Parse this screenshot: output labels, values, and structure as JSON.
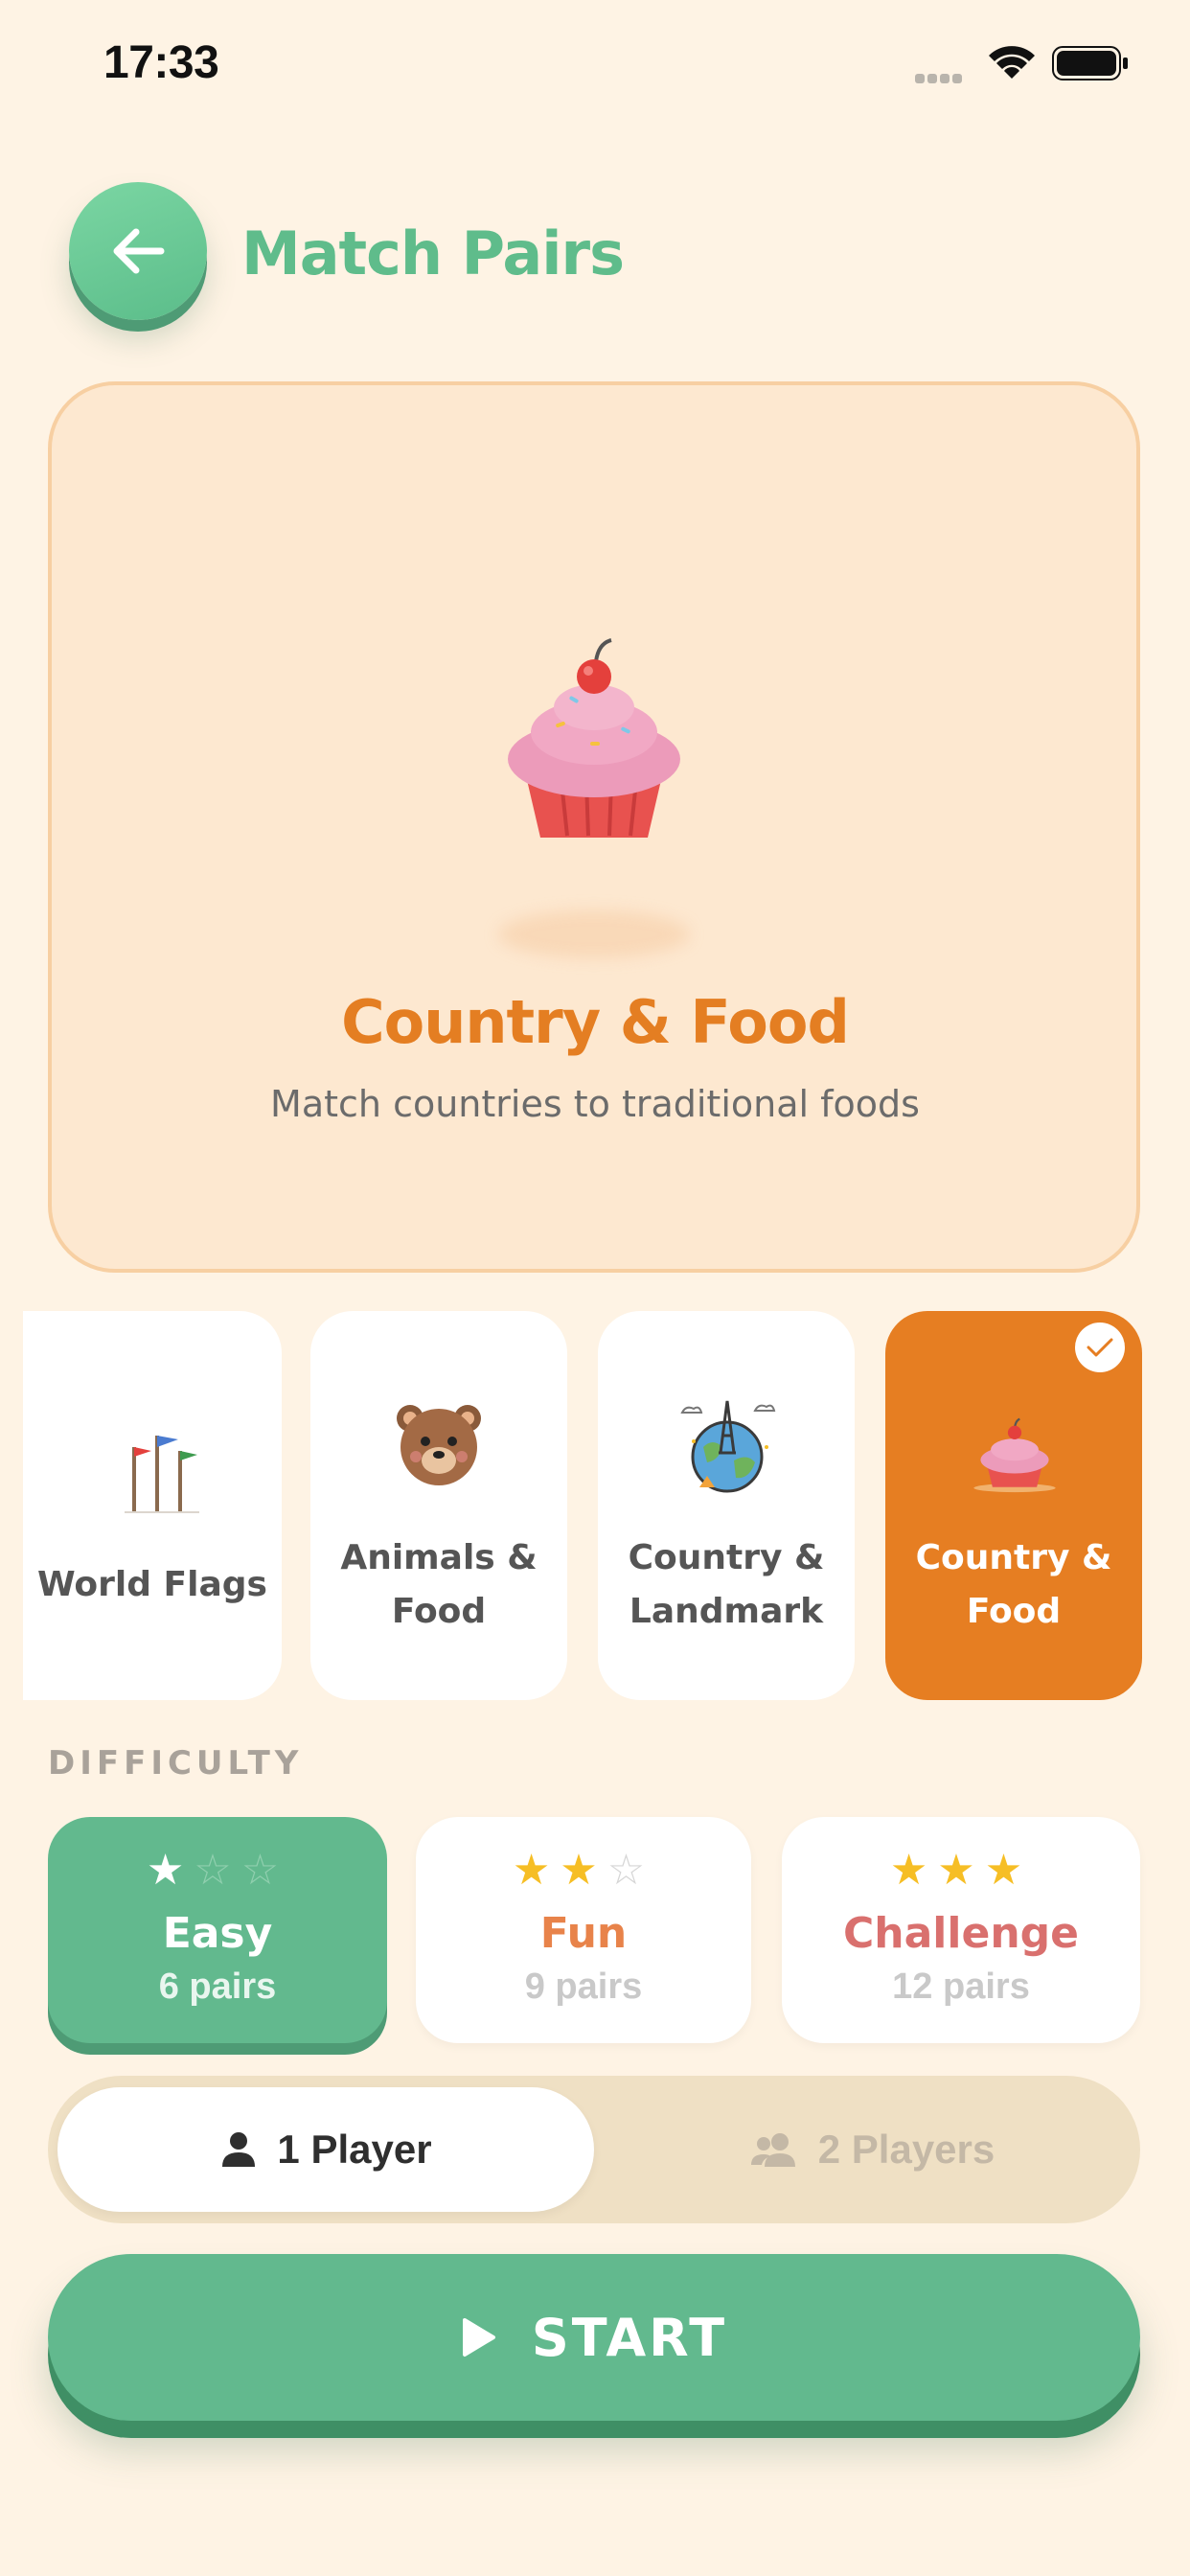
{
  "status_bar": {
    "time": "17:33"
  },
  "header": {
    "title": "Match Pairs"
  },
  "hero": {
    "title": "Country & Food",
    "subtitle": "Match countries to traditional foods",
    "icon": "cupcake-icon"
  },
  "categories": [
    {
      "label": "World Flags",
      "icon": "flags-icon",
      "selected": false
    },
    {
      "label": "Animals & Food",
      "icon": "bear-icon",
      "selected": false
    },
    {
      "label": "Country & Landmark",
      "icon": "globe-landmark-icon",
      "selected": false
    },
    {
      "label": "Country & Food",
      "icon": "cupcake-icon",
      "selected": true
    }
  ],
  "difficulty": {
    "header": "DIFFICULTY",
    "options": [
      {
        "name": "Easy",
        "pairs": "6 pairs",
        "stars": 1,
        "selected": true,
        "color": "#FFFFFF"
      },
      {
        "name": "Fun",
        "pairs": "9 pairs",
        "stars": 2,
        "selected": false,
        "color": "#E8834A"
      },
      {
        "name": "Challenge",
        "pairs": "12 pairs",
        "stars": 3,
        "selected": false,
        "color": "#D9706E"
      }
    ]
  },
  "players": {
    "options": [
      {
        "label": "1 Player",
        "icon": "person-icon",
        "selected": true
      },
      {
        "label": "2 Players",
        "icon": "people-icon",
        "selected": false
      }
    ]
  },
  "start": {
    "label": "START",
    "icon": "play-icon"
  },
  "colors": {
    "background": "#FEF3E4",
    "green": "#62B98E",
    "orange": "#E67E22",
    "star": "#F6BE25"
  }
}
